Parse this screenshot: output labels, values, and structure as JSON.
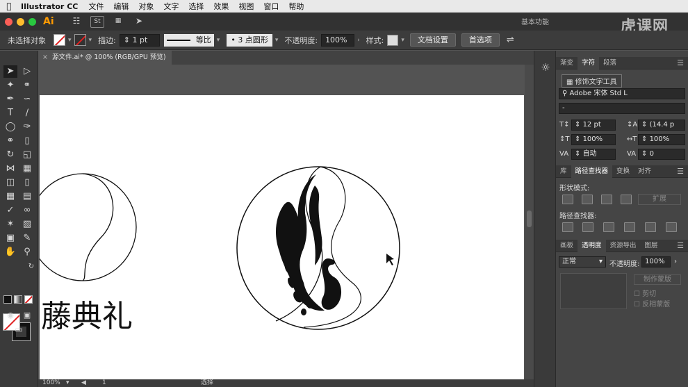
{
  "menubar": {
    "app_name": "Illustrator CC",
    "items": [
      "文件",
      "编辑",
      "对象",
      "文字",
      "选择",
      "效果",
      "视图",
      "窗口",
      "帮助"
    ]
  },
  "appbar": {
    "logo": "Ai",
    "stock_label": "St",
    "workspace": "基本功能",
    "watermark": "虎课网"
  },
  "controlbar": {
    "selection_status": "未选择对象",
    "stroke_label": "描边:",
    "stroke_weight": "1 pt",
    "stroke_style": "等比",
    "brush_profile": "3 点圆形",
    "opacity_label": "不透明度:",
    "opacity_value": "100%",
    "style_label": "样式:",
    "doc_setup_button": "文档设置",
    "preferences_button": "首选项"
  },
  "document": {
    "tab_title": "源文件.ai* @ 100% (RGB/GPU 预览)"
  },
  "artboard": {
    "title_text": "藤典礼"
  },
  "statusbar": {
    "zoom": "100%",
    "artboard_number": "1",
    "tool_status": "选择"
  },
  "character_panel": {
    "tabs": [
      "渐变",
      "字符",
      "段落"
    ],
    "active_tab": "字符",
    "touch_type_label": "修饰文字工具",
    "font_family": "Adobe 宋体 Std L",
    "font_style": "-",
    "font_size": "12 pt",
    "leading": "(14.4 p",
    "vertical_scale": "100%",
    "horizontal_scale": "100%",
    "kerning": "自动",
    "tracking": "0"
  },
  "pathfinder_panel": {
    "tabs": [
      "库",
      "路径查找器",
      "变换",
      "对齐"
    ],
    "active_tab": "路径查找器",
    "shape_modes_label": "形状模式:",
    "expand_button": "扩展",
    "pathfinders_label": "路径查找器:"
  },
  "transparency_panel": {
    "tabs": [
      "画板",
      "透明度",
      "资源导出",
      "图层"
    ],
    "active_tab": "透明度",
    "blend_mode": "正常",
    "opacity_label": "不透明度:",
    "opacity_value": "100%",
    "make_mask_button": "制作蒙版",
    "clip_label": "剪切",
    "invert_mask_label": "反相蒙版"
  },
  "colors": {
    "accent": "#ff9a00",
    "none_swatch_slash": "#e02020"
  }
}
